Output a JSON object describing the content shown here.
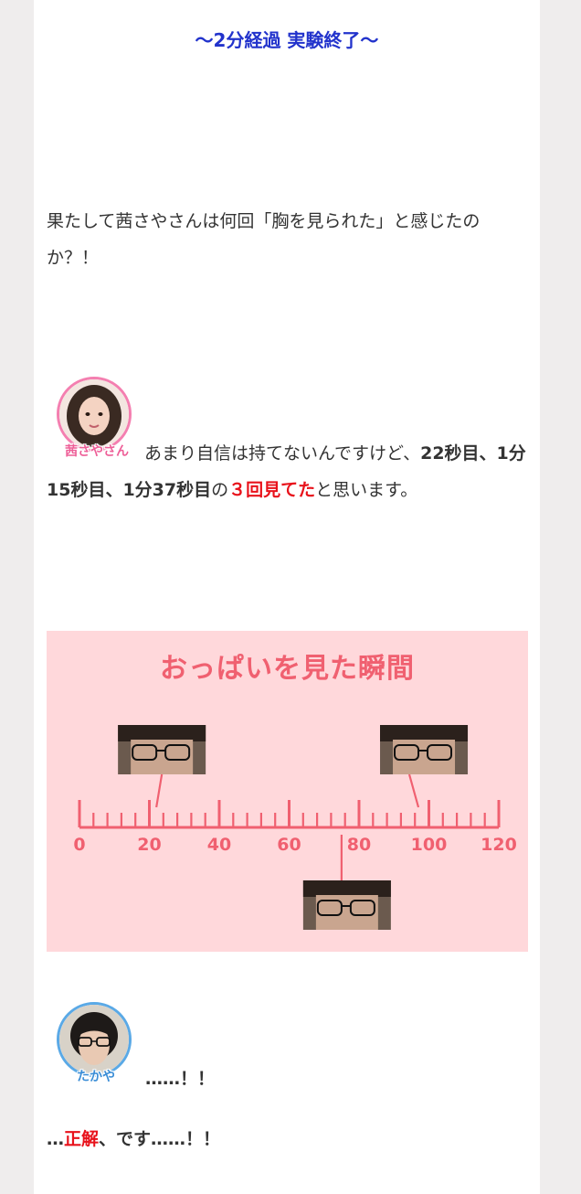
{
  "heading": "〜2分経過 実験終了〜",
  "question": "果たして茜さやさんは何回「胸を見られた」と感じたのか？！",
  "speaker1": {
    "name": "茜さやさん",
    "text_1": "あまり自信は持てないんですけど、",
    "bold_1": "22秒目、1分15秒目、1分37秒目",
    "text_2": "の",
    "red_1": "３回見てた",
    "text_3": "と思います。"
  },
  "chart_data": {
    "type": "timeline",
    "title": "おっぱいを見た瞬間",
    "axis_min": 0,
    "axis_max": 120,
    "tick_labels": [
      "0",
      "20",
      "40",
      "60",
      "80",
      "100",
      "120"
    ],
    "minor_tick_step": 4,
    "moments": [
      {
        "time_seconds": 22,
        "photo_side": "above"
      },
      {
        "time_seconds": 75,
        "photo_side": "below"
      },
      {
        "time_seconds": 97,
        "photo_side": "above"
      }
    ],
    "colors": {
      "background": "#ffd8db",
      "ruler": "#f06070",
      "text": "#f06070"
    }
  },
  "speaker2": {
    "name": "たかや",
    "text": "……！！"
  },
  "answer": {
    "pre": "…",
    "red": "正解",
    "post": "、です……！！"
  },
  "colors": {
    "heading": "#2233cc",
    "highlight": "#e8121b",
    "body_text": "#333333"
  }
}
